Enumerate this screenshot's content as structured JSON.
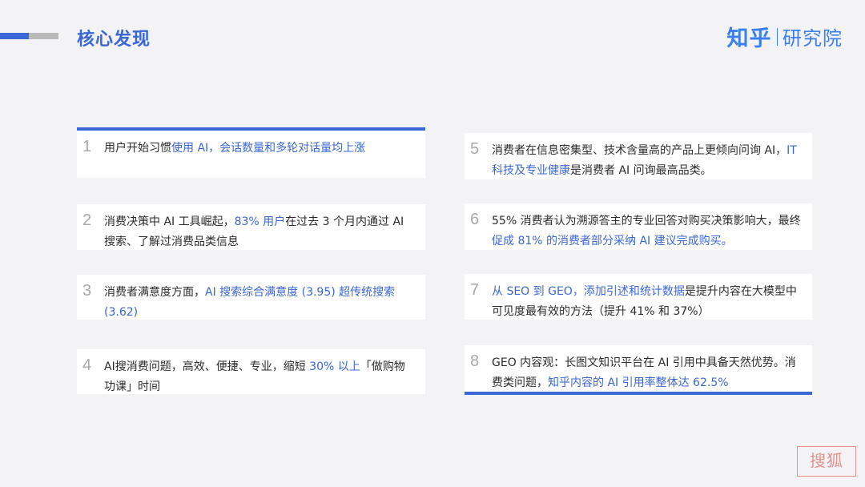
{
  "header": {
    "title": "核心发现",
    "logo_main": "知乎",
    "logo_sub": "研究院"
  },
  "findings": [
    {
      "num": "1",
      "segments": [
        {
          "t": "用户开始习惯",
          "hl": false
        },
        {
          "t": "使用 AI，会话数量和多轮对话量均上涨",
          "hl": true
        }
      ]
    },
    {
      "num": "2",
      "segments": [
        {
          "t": "消费决策中 AI 工具崛起，",
          "hl": false
        },
        {
          "t": "83% 用户",
          "hl": true
        },
        {
          "t": "在过去 3 个月内通过 AI 搜索、了解过消费品类信息",
          "hl": false
        }
      ]
    },
    {
      "num": "3",
      "segments": [
        {
          "t": "消费者满意度方面，",
          "hl": false
        },
        {
          "t": "AI 搜索综合满意度 (3.95) 超传统搜索 (3.62)",
          "hl": true
        }
      ]
    },
    {
      "num": "4",
      "segments": [
        {
          "t": "AI搜消费问题，高效、便捷、专业，缩短 ",
          "hl": false
        },
        {
          "t": "30% 以上",
          "hl": true
        },
        {
          "t": "「做购物功课」时间",
          "hl": false
        }
      ]
    },
    {
      "num": "5",
      "segments": [
        {
          "t": "消费者在信息密集型、技术含量高的产品上更倾向问询 AI，",
          "hl": false
        },
        {
          "t": "IT 科技及专业健康",
          "hl": true
        },
        {
          "t": "是消费者 AI 问询最高品类。",
          "hl": false
        }
      ]
    },
    {
      "num": "6",
      "segments": [
        {
          "t": "55% 消费者认为溯源答主的专业回答对购买决策影响大，最终",
          "hl": false
        },
        {
          "t": "促成 81% 的消费者部分采纳 AI 建议完成购买。",
          "hl": true
        }
      ]
    },
    {
      "num": "7",
      "segments": [
        {
          "t": "从 SEO 到 GEO，添加引述和统计数据",
          "hl": true
        },
        {
          "t": "是提升内容在大模型中可见度最有效的方法（提升 41% 和 37%）",
          "hl": false
        }
      ]
    },
    {
      "num": "8",
      "segments": [
        {
          "t": "GEO 内容观：长图文知识平台在 AI 引用中具备天然优势。消费类问题，",
          "hl": false
        },
        {
          "t": "知乎内容的 AI 引用率整体达 62.5%",
          "hl": true
        }
      ]
    }
  ],
  "stamp": {
    "text": "搜狐"
  },
  "colors": {
    "accent": "#3a66d6",
    "background": "#f3f3f5",
    "logo": "#3a7ff0"
  }
}
